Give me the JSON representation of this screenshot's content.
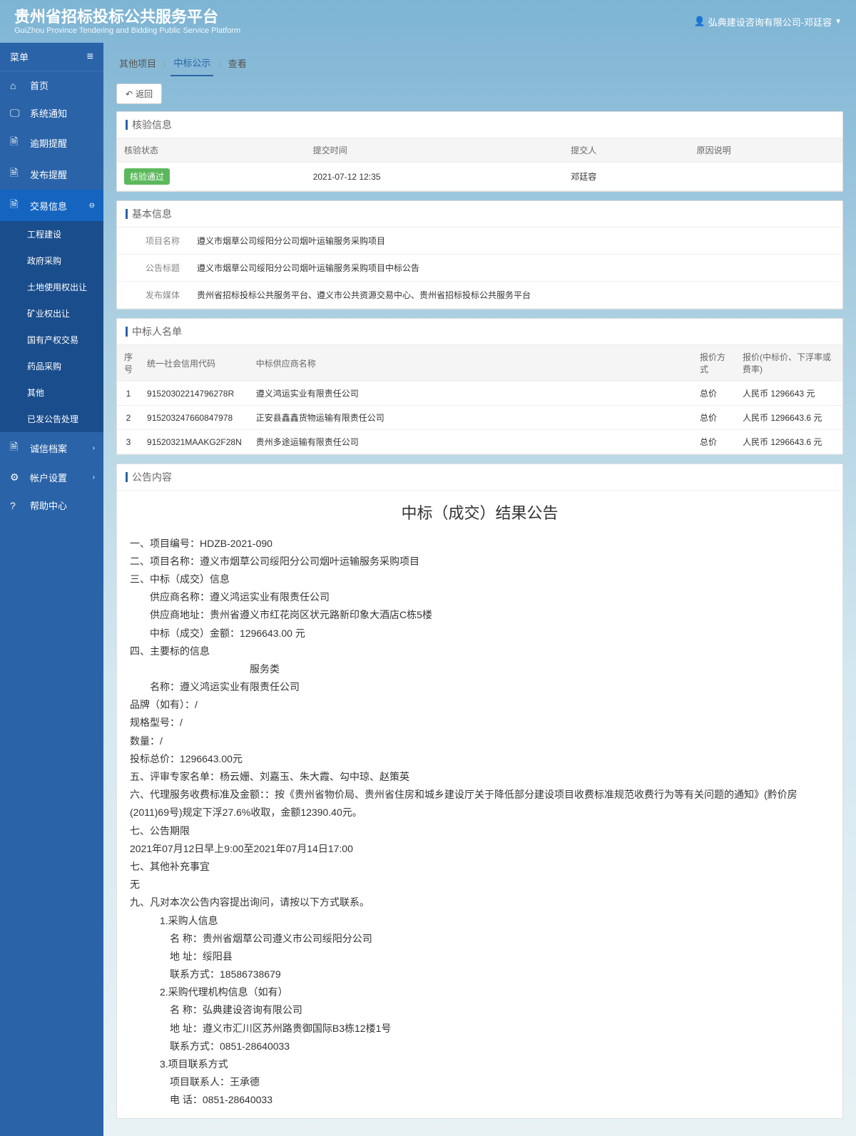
{
  "header": {
    "title_cn": "贵州省招标投标公共服务平台",
    "title_en": "GuiZhou Province Tendering and Bidding Public Service Platform",
    "user_label": "弘典建设咨询有限公司-邓廷容"
  },
  "menu": {
    "title": "菜单",
    "items": [
      {
        "icon": "⌂",
        "label": "首页"
      },
      {
        "icon": "🖵",
        "label": "系统通知"
      },
      {
        "icon": "🗎",
        "label": "逾期提醒"
      },
      {
        "icon": "🗎",
        "label": "发布提醒"
      },
      {
        "icon": "🗎",
        "label": "交易信息",
        "active": true,
        "expand": "⊖"
      },
      {
        "icon": "🗎",
        "label": "诚信档案",
        "expand": "›"
      },
      {
        "icon": "⚙",
        "label": "帐户设置",
        "expand": "›"
      },
      {
        "icon": "?",
        "label": "帮助中心"
      }
    ],
    "submenu": [
      "工程建设",
      "政府采购",
      "土地使用权出让",
      "矿业权出让",
      "国有产权交易",
      "药品采购",
      "其他",
      "已发公告处理"
    ]
  },
  "breadcrumb": [
    "其他项目",
    "中标公示",
    "查看"
  ],
  "back_btn": "返回",
  "verify": {
    "title": "核验信息",
    "headers": [
      "核验状态",
      "提交时间",
      "提交人",
      "原因说明"
    ],
    "row": {
      "status": "核验通过",
      "time": "2021-07-12 12:35",
      "person": "邓廷容",
      "reason": ""
    }
  },
  "basic": {
    "title": "基本信息",
    "rows": [
      {
        "label": "项目名称",
        "value": "遵义市烟草公司绥阳分公司烟叶运输服务采购项目"
      },
      {
        "label": "公告标题",
        "value": "遵义市烟草公司绥阳分公司烟叶运输服务采购项目中标公告"
      },
      {
        "label": "发布媒体",
        "value": "贵州省招标投标公共服务平台、遵义市公共资源交易中心、贵州省招标投标公共服务平台"
      }
    ]
  },
  "winners": {
    "title": "中标人名单",
    "headers": [
      "序号",
      "统一社会信用代码",
      "中标供应商名称",
      "报价方式",
      "报价(中标价、下浮率或费率)"
    ],
    "rows": [
      {
        "no": "1",
        "code": "91520302214796278R",
        "name": "遵义鸿运实业有限责任公司",
        "method": "总价",
        "price": "人民币 1296643 元"
      },
      {
        "no": "2",
        "code": "915203247660847978",
        "name": "正安县鑫鑫货物运输有限责任公司",
        "method": "总价",
        "price": "人民币 1296643.6 元"
      },
      {
        "no": "3",
        "code": "91520321MAAKG2F28N",
        "name": "贵州多途运输有限责任公司",
        "method": "总价",
        "price": "人民币 1296643.6 元"
      }
    ]
  },
  "announce": {
    "title": "公告内容",
    "heading": "中标（成交）结果公告",
    "l1": "一、项目编号：HDZB-2021-090",
    "l2": "二、项目名称：遵义市烟草公司绥阳分公司烟叶运输服务采购项目",
    "l3": "三、中标（成交）信息",
    "l3a": "供应商名称：遵义鸿运实业有限责任公司",
    "l3b": "供应商地址：贵州省遵义市红花岗区状元路新印象大酒店C栋5楼",
    "l3c": "中标（成交）金额：1296643.00   元",
    "l4": "四、主要标的信息",
    "l4_cat": "服务类",
    "l4a": "名称：遵义鸿运实业有限责任公司",
    "l4b": "品牌（如有）：/",
    "l4c": "规格型号：/",
    "l4d": "数量：/",
    "l4e": "投标总价：1296643.00元",
    "l5": "五、评审专家名单：杨云姗、刘嘉玉、朱大霞、勾中琼、赵策英",
    "l6": "六、代理服务收费标准及金额：：按《贵州省物价局、贵州省住房和城乡建设厅关于降低部分建设项目收费标准规范收费行为等有关问题的通知》(黔价房(2011)69号)规定下浮27.6%收取，金额12390.40元。",
    "l7": "七、公告期限",
    "l7a": "2021年07月12日早上9:00至2021年07月14日17:00",
    "l7b": "七、其他补充事宜",
    "l7c": "无",
    "l9": "九、凡对本次公告内容提出询问，请按以下方式联系。",
    "l9_1": "1.采购人信息",
    "l9_1a": "名           称：贵州省烟草公司遵义市公司绥阳分公司",
    "l9_1b": "地           址：绥阳县",
    "l9_1c": "联系方式：18586738679",
    "l9_2": "2.采购代理机构信息（如有）",
    "l9_2a": "名           称：弘典建设咨询有限公司",
    "l9_2b": "地           址：遵义市汇川区苏州路贵御国际B3栋12楼1号",
    "l9_2c": "联系方式：0851-28640033",
    "l9_3": "3.项目联系方式",
    "l9_3a": "项目联系人：王承德",
    "l9_3b": "电           话：0851-28640033"
  }
}
